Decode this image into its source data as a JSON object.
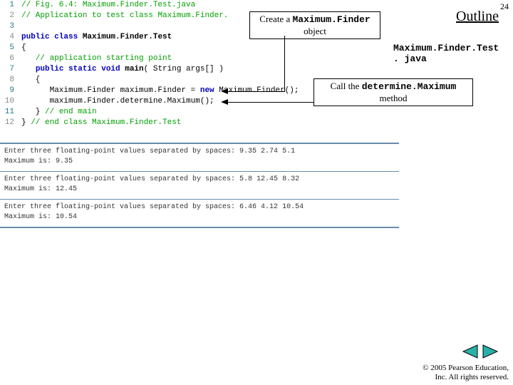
{
  "page_number": "24",
  "outline_title": "Outline",
  "file_label_line1": "Maximum.Finder.Test",
  "file_label_line2": ". java",
  "callout1": {
    "pre": "Create a ",
    "mono": "Maximum.Finder",
    "post": "object"
  },
  "callout2": {
    "pre": "Call the ",
    "mono": "determine.Maximum",
    "post": "method"
  },
  "code": [
    {
      "n": "1",
      "frags": [
        {
          "cls": "c-comment",
          "t": "// Fig. 6.4: Maximum.Finder.Test.java"
        }
      ]
    },
    {
      "n": "2",
      "frags": [
        {
          "cls": "c-comment",
          "t": "// Application to test class Maximum.Finder."
        }
      ]
    },
    {
      "n": "3",
      "frags": []
    },
    {
      "n": "4",
      "frags": [
        {
          "cls": "c-keyword",
          "t": "public class "
        },
        {
          "cls": "c-ident",
          "t": "Maximum.Finder.Test"
        }
      ]
    },
    {
      "n": "5",
      "frags": [
        {
          "cls": "c-plain",
          "t": "{"
        }
      ]
    },
    {
      "n": "6",
      "frags": [
        {
          "cls": "c-plain",
          "t": "   "
        },
        {
          "cls": "c-comment",
          "t": "// application starting point"
        }
      ]
    },
    {
      "n": "7",
      "frags": [
        {
          "cls": "c-plain",
          "t": "   "
        },
        {
          "cls": "c-keyword",
          "t": "public static void "
        },
        {
          "cls": "c-ident",
          "t": "main"
        },
        {
          "cls": "c-plain",
          "t": "( String args[] )"
        }
      ]
    },
    {
      "n": "8",
      "frags": [
        {
          "cls": "c-plain",
          "t": "   {"
        }
      ]
    },
    {
      "n": "9",
      "frags": [
        {
          "cls": "c-plain",
          "t": "      Maximum.Finder maximum.Finder = "
        },
        {
          "cls": "c-keyword",
          "t": "new"
        },
        {
          "cls": "c-plain",
          "t": " Maximum.Finder();"
        }
      ]
    },
    {
      "n": "10",
      "frags": [
        {
          "cls": "c-plain",
          "t": "      maximum.Finder.determine.Maximum();"
        }
      ]
    },
    {
      "n": "11",
      "frags": [
        {
          "cls": "c-plain",
          "t": "   } "
        },
        {
          "cls": "c-comment",
          "t": "// end main"
        }
      ]
    },
    {
      "n": "12",
      "frags": [
        {
          "cls": "c-plain",
          "t": "} "
        },
        {
          "cls": "c-comment",
          "t": "// end class Maximum.Finder.Test"
        }
      ]
    }
  ],
  "output": [
    "Enter three floating-point values separated by spaces: 9.35 2.74 5.1\nMaximum is: 9.35",
    "Enter three floating-point values separated by spaces: 5.8 12.45 8.32\nMaximum is: 12.45",
    "Enter three floating-point values separated by spaces: 6.46 4.12 10.54\nMaximum is: 10.54"
  ],
  "copyright_line1": "© 2005 Pearson Education,",
  "copyright_line2": "Inc.  All rights reserved.",
  "nav": {
    "prev": "◀",
    "next": "▶"
  }
}
